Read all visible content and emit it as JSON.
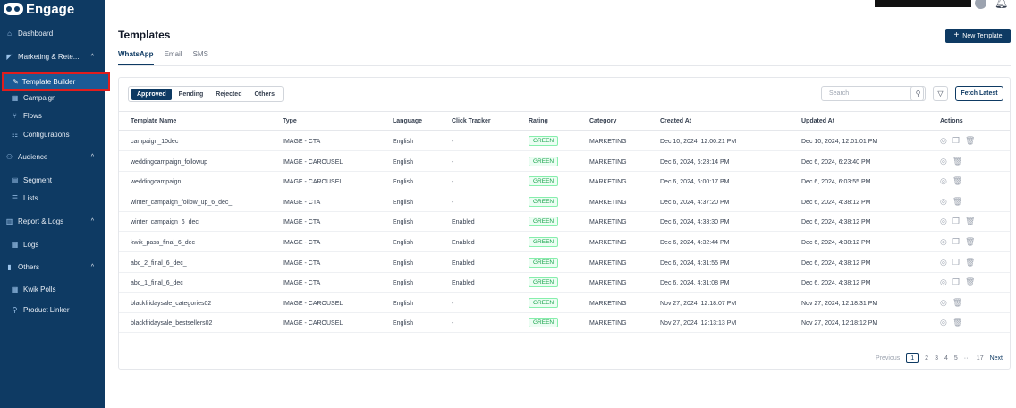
{
  "app": {
    "logo_text": "Engage"
  },
  "sidebar": {
    "items": [
      {
        "label": "Dashboard",
        "icon": "home-icon",
        "glyph": "⌂"
      },
      {
        "label": "Marketing & Rete...",
        "icon": "megaphone-icon",
        "glyph": "◤",
        "expanded": true
      },
      {
        "label": "Template Builder",
        "icon": "brush-icon",
        "glyph": "✎",
        "active": true
      },
      {
        "label": "Campaign",
        "icon": "grid-icon",
        "glyph": "▦"
      },
      {
        "label": "Flows",
        "icon": "flow-icon",
        "glyph": "⑂"
      },
      {
        "label": "Configurations",
        "icon": "sliders-icon",
        "glyph": "☷"
      },
      {
        "label": "Audience",
        "icon": "audience-icon",
        "glyph": "⚇",
        "expanded": true
      },
      {
        "label": "Segment",
        "icon": "segment-icon",
        "glyph": "▤"
      },
      {
        "label": "Lists",
        "icon": "list-icon",
        "glyph": "☰"
      },
      {
        "label": "Report & Logs",
        "icon": "report-icon",
        "glyph": "▥",
        "expanded": true
      },
      {
        "label": "Logs",
        "icon": "logs-icon",
        "glyph": "▦"
      },
      {
        "label": "Others",
        "icon": "bar-chart-icon",
        "glyph": "▮",
        "expanded": true
      },
      {
        "label": "Kwik Polls",
        "icon": "polls-icon",
        "glyph": "▦"
      },
      {
        "label": "Product Linker",
        "icon": "link-icon",
        "glyph": "⚲"
      }
    ]
  },
  "header": {
    "title": "Templates",
    "new_button": "New Template",
    "tabs": [
      "WhatsApp",
      "Email",
      "SMS"
    ]
  },
  "filters": {
    "status": [
      "Approved",
      "Pending",
      "Rejected",
      "Others"
    ],
    "search_placeholder": "Search",
    "fetch_button": "Fetch Latest"
  },
  "table": {
    "columns": [
      "Template Name",
      "Type",
      "Language",
      "Click Tracker",
      "Rating",
      "Category",
      "Created At",
      "Updated At",
      "Actions"
    ],
    "rows": [
      {
        "name": "campaign_10dec",
        "type": "IMAGE - CTA",
        "language": "English",
        "click": "-",
        "rating": "GREEN",
        "category": "MARKETING",
        "created": "Dec 10, 2024, 12:00:21 PM",
        "updated": "Dec 10, 2024, 12:01:01 PM",
        "copy": true
      },
      {
        "name": "weddingcampaign_followup",
        "type": "IMAGE - CAROUSEL",
        "language": "English",
        "click": "-",
        "rating": "GREEN",
        "category": "MARKETING",
        "created": "Dec 6, 2024, 6:23:14 PM",
        "updated": "Dec 6, 2024, 6:23:40 PM",
        "copy": false
      },
      {
        "name": "weddingcampaign",
        "type": "IMAGE - CAROUSEL",
        "language": "English",
        "click": "-",
        "rating": "GREEN",
        "category": "MARKETING",
        "created": "Dec 6, 2024, 6:00:17 PM",
        "updated": "Dec 6, 2024, 6:03:55 PM",
        "copy": false
      },
      {
        "name": "winter_campaign_follow_up_6_dec_",
        "type": "IMAGE - CTA",
        "language": "English",
        "click": "-",
        "rating": "GREEN",
        "category": "MARKETING",
        "created": "Dec 6, 2024, 4:37:20 PM",
        "updated": "Dec 6, 2024, 4:38:12 PM",
        "copy": false
      },
      {
        "name": "winter_campaign_6_dec",
        "type": "IMAGE - CTA",
        "language": "English",
        "click": "Enabled",
        "rating": "GREEN",
        "category": "MARKETING",
        "created": "Dec 6, 2024, 4:33:30 PM",
        "updated": "Dec 6, 2024, 4:38:12 PM",
        "copy": true
      },
      {
        "name": "kwik_pass_final_6_dec",
        "type": "IMAGE - CTA",
        "language": "English",
        "click": "Enabled",
        "rating": "GREEN",
        "category": "MARKETING",
        "created": "Dec 6, 2024, 4:32:44 PM",
        "updated": "Dec 6, 2024, 4:38:12 PM",
        "copy": true
      },
      {
        "name": "abc_2_final_6_dec_",
        "type": "IMAGE - CTA",
        "language": "English",
        "click": "Enabled",
        "rating": "GREEN",
        "category": "MARKETING",
        "created": "Dec 6, 2024, 4:31:55 PM",
        "updated": "Dec 6, 2024, 4:38:12 PM",
        "copy": true
      },
      {
        "name": "abc_1_final_6_dec",
        "type": "IMAGE - CTA",
        "language": "English",
        "click": "Enabled",
        "rating": "GREEN",
        "category": "MARKETING",
        "created": "Dec 6, 2024, 4:31:08 PM",
        "updated": "Dec 6, 2024, 4:38:12 PM",
        "copy": true
      },
      {
        "name": "blackfridaysale_categories02",
        "type": "IMAGE - CAROUSEL",
        "language": "English",
        "click": "-",
        "rating": "GREEN",
        "category": "MARKETING",
        "created": "Nov 27, 2024, 12:18:07 PM",
        "updated": "Nov 27, 2024, 12:18:31 PM",
        "copy": false
      },
      {
        "name": "blackfridaysale_bestsellers02",
        "type": "IMAGE - CAROUSEL",
        "language": "English",
        "click": "-",
        "rating": "GREEN",
        "category": "MARKETING",
        "created": "Nov 27, 2024, 12:13:13 PM",
        "updated": "Nov 27, 2024, 12:18:12 PM",
        "copy": false
      }
    ]
  },
  "pagination": {
    "previous": "Previous",
    "pages": [
      "1",
      "2",
      "3",
      "4",
      "5"
    ],
    "ellipsis": "···",
    "last": "17",
    "next": "Next",
    "current": "1"
  },
  "colors": {
    "brand": "#0e3a63",
    "highlight": "#e11d1d",
    "rating_green": "#16a34a"
  }
}
